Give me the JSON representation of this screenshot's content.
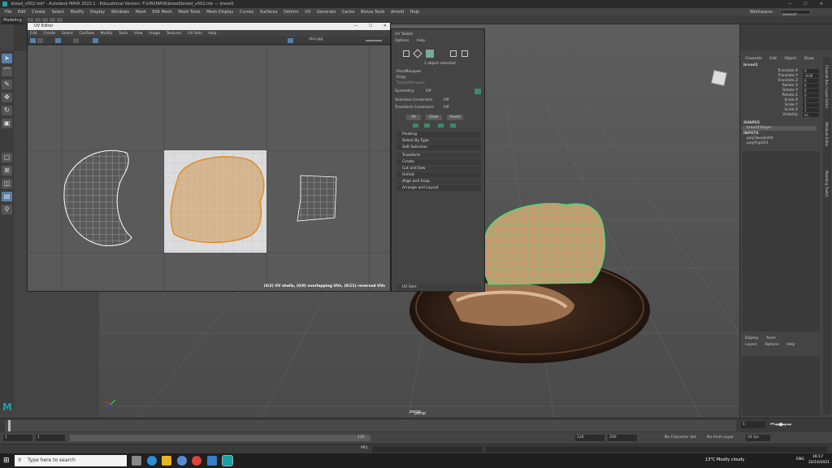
{
  "app": {
    "title": "bread_v002.mb* - Autodesk MAYA 2022.1 - Educational Version: F:\\UNI\\MAYA\\bread\\bread_v002.mb --- bread1",
    "window_controls": [
      "—",
      "☐",
      "✕"
    ]
  },
  "menubar": {
    "items": [
      "File",
      "Edit",
      "Create",
      "Select",
      "Modify",
      "Display",
      "Windows",
      "Mesh",
      "Edit Mesh",
      "Mesh Tools",
      "Mesh Display",
      "Curves",
      "Surfaces",
      "Deform",
      "UV",
      "Generate",
      "Cache",
      "Bonus Tools",
      "Arnold",
      "Help"
    ],
    "workspace_label": "Workspace:",
    "workspace_value": "General*"
  },
  "statusline": {
    "mode": "Modeling"
  },
  "uv_editor": {
    "title": "UV Editor",
    "controls": [
      "—",
      "☐",
      "✕"
    ],
    "menu": [
      "Edit",
      "Create",
      "Select",
      "Cut/Sew",
      "Modify",
      "Tools",
      "View",
      "Image",
      "Textures",
      "UV Sets",
      "Help"
    ],
    "texture_name": "diss.jpg",
    "status": "(0/2) UV shells, (0/0) overlapping UVs, (0/11) reversed UVs",
    "tick_labels_x": [
      "-1.2",
      "-1.1",
      "-1",
      "-0.9",
      "-0.8",
      "-0.7",
      "-0.6",
      "0.1",
      "0.2",
      "0.3",
      "0.4",
      "0.5",
      "0.6",
      "0.7",
      "0.8",
      "0.9",
      "1.1",
      "1.2",
      "1.3",
      "1.4",
      "1.5",
      "1.6",
      "1.7"
    ],
    "tick_labels_y": [
      "1.8",
      "1.7",
      "1.6",
      "1.5",
      "1.4",
      "1.3",
      "1.2",
      "1.1",
      "0.9",
      "0.8",
      "0.7",
      "0.6",
      "0.5",
      "0.4",
      "0.3",
      "0.2",
      "0.1",
      "-0.1",
      "-0.2",
      "-0.3"
    ]
  },
  "uv_toolkit": {
    "title": "UV Toolkit",
    "menu": [
      "Options",
      "Help"
    ],
    "selection_text": "1 object selected",
    "modes": [
      "Pick/Marquee",
      "Drag",
      "Tweak/Marquee"
    ],
    "symmetry_label": "Symmetry:",
    "symmetry_value": "Off",
    "selection_constraint_label": "Selection Constraint:",
    "selection_constraint_value": "Off",
    "transform_constraint_label": "Transform Constraint:",
    "transform_constraint_value": "Off",
    "buttons": [
      "All",
      "Clear",
      "Invert"
    ],
    "sections": [
      "Pivoting",
      "Select By Type",
      "Soft Selection",
      "Transform",
      "Create",
      "Cut and Sew",
      "Unfold",
      "Align and Snap",
      "Arrange and Layout",
      "UV Sets"
    ]
  },
  "viewport": {
    "camera": "persp"
  },
  "channel_box": {
    "tabs": [
      "Channels",
      "Edit",
      "Object",
      "Show"
    ],
    "object": "bread1",
    "attributes": [
      {
        "name": "Translate X",
        "value": "0"
      },
      {
        "name": "Translate Y",
        "value": "-0.09"
      },
      {
        "name": "Translate Z",
        "value": "0"
      },
      {
        "name": "Rotate X",
        "value": "0"
      },
      {
        "name": "Rotate Y",
        "value": "0"
      },
      {
        "name": "Rotate Z",
        "value": "0"
      },
      {
        "name": "Scale X",
        "value": "1"
      },
      {
        "name": "Scale Y",
        "value": "1"
      },
      {
        "name": "Scale Z",
        "value": "1"
      },
      {
        "name": "Visibility",
        "value": "on"
      }
    ],
    "shapes_header": "SHAPES",
    "shape": "bread1Shape",
    "inputs_header": "INPUTS",
    "inputs": [
      "polyTweakUV4",
      "polyFlipUV1"
    ],
    "layer_tabs": [
      "Display",
      "Anim"
    ],
    "layer_menu": [
      "Layers",
      "Options",
      "Help"
    ],
    "side_tabs": [
      "Channel Box / Layer Editor",
      "Attribute Editor",
      "Modeling Toolkit"
    ]
  },
  "timeline": {
    "ticks": [
      "5",
      "10",
      "15",
      "20",
      "25",
      "30",
      "35",
      "40",
      "45",
      "50",
      "55",
      "60",
      "65",
      "70",
      "75",
      "80",
      "85",
      "90",
      "95",
      "100",
      "105",
      "110",
      "115",
      "120"
    ],
    "current_frame": "1",
    "range_start": "1",
    "range_start_inner": "1",
    "range_end_inner": "120",
    "range_end": "120",
    "anim_end": "200",
    "character_set": "No Character Set",
    "anim_layer": "No Anim Layer",
    "fps": "24 fps"
  },
  "cmdline": {
    "label": "MEL"
  },
  "taskbar": {
    "search_placeholder": "Type here to search",
    "weather": "13°C  Mostly cloudy",
    "lang": "ENG",
    "time": "16:17",
    "date": "22/10/2021"
  },
  "colors": {
    "maya_bg": "#444444",
    "viewport_bg": "#5c5c5c",
    "wireframe_select": "#3ee07a",
    "uv_highlight": "#e08a2a",
    "taskbar": "#1f1f1f"
  }
}
